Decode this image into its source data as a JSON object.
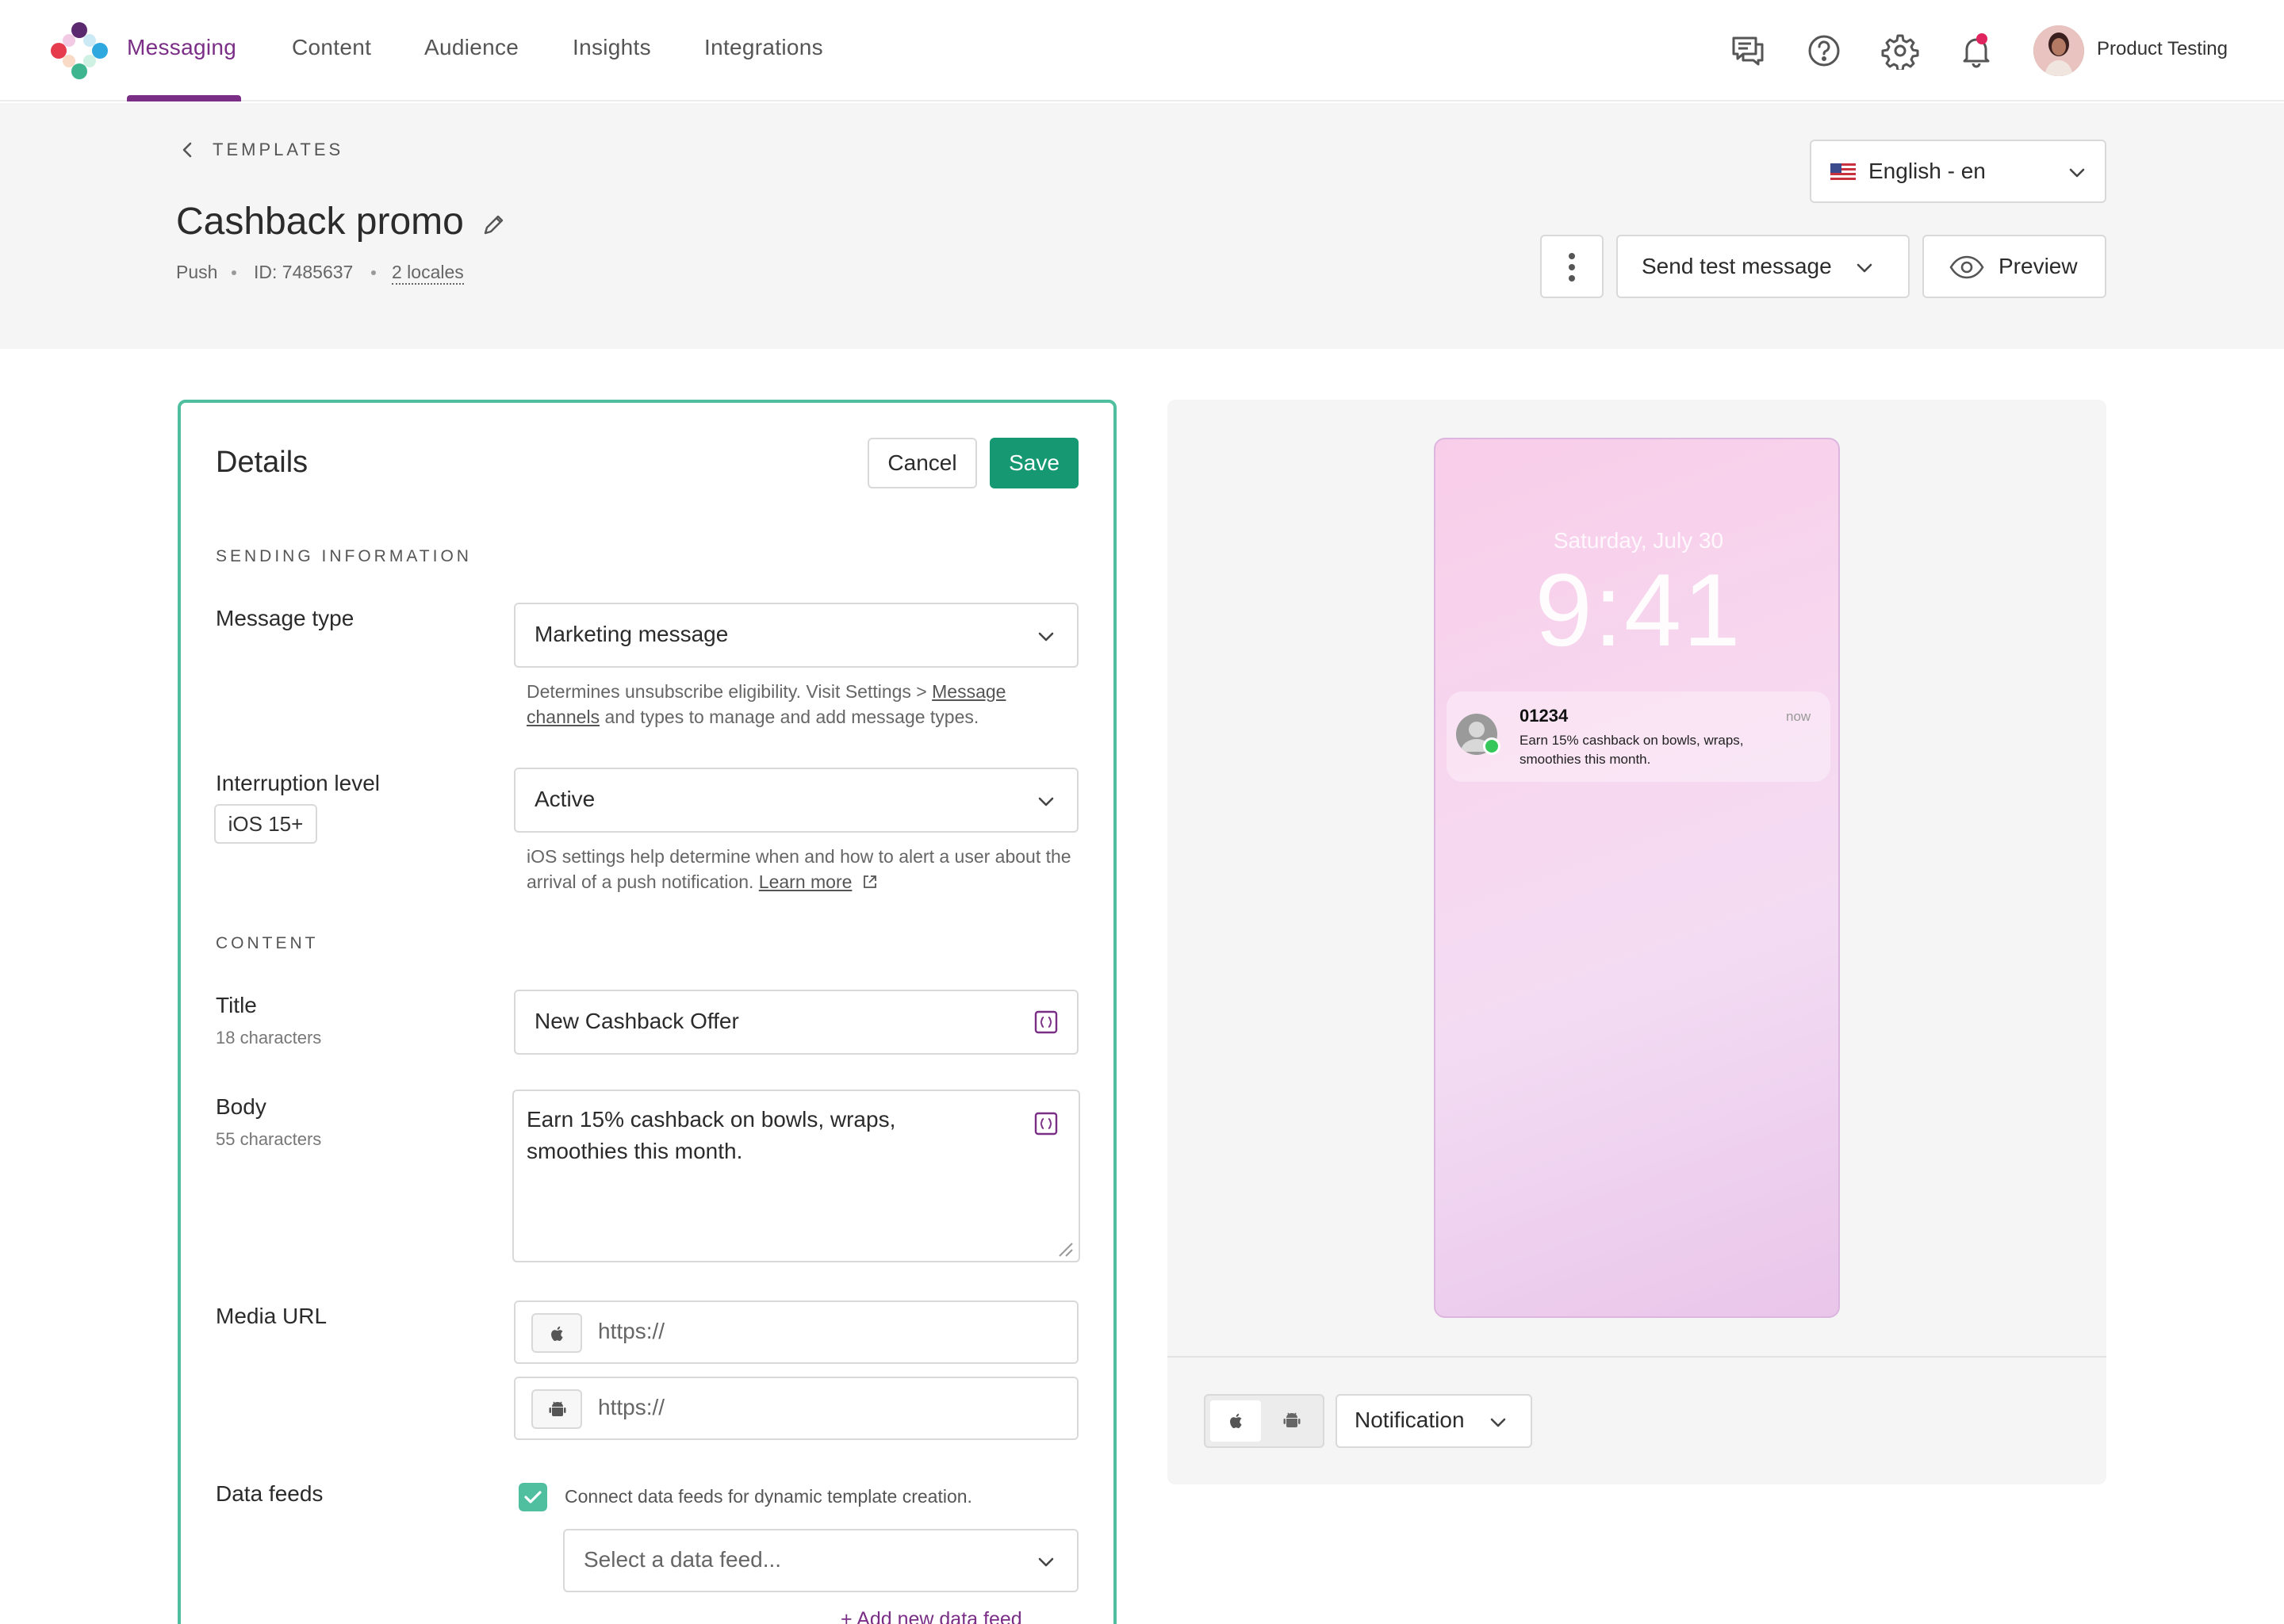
{
  "nav": {
    "tabs": [
      {
        "label": "Messaging",
        "active": true
      },
      {
        "label": "Content",
        "active": false
      },
      {
        "label": "Audience",
        "active": false
      },
      {
        "label": "Insights",
        "active": false
      },
      {
        "label": "Integrations",
        "active": false
      }
    ],
    "icons": [
      "chat-icon",
      "help-icon",
      "gear-icon",
      "bell-icon"
    ],
    "user_name": "Product Testing",
    "accent": "#7a2e86"
  },
  "header": {
    "back_label": "TEMPLATES",
    "title": "Cashback promo",
    "meta": {
      "channel": "Push",
      "id": "ID: 7485637",
      "locales": "2 locales"
    },
    "language": "English - en",
    "send_test_label": "Send test message",
    "preview_label": "Preview"
  },
  "details": {
    "title": "Details",
    "cancel_label": "Cancel",
    "save_label": "Save",
    "sending_section": "SENDING INFORMATION",
    "message_type": {
      "label": "Message type",
      "value": "Marketing message",
      "help_prefix": "Determines unsubscribe eligibility. Visit Settings > ",
      "help_link": "Message channels",
      "help_suffix": " and types to manage and add message types."
    },
    "interruption": {
      "label": "Interruption level",
      "badge": "iOS 15+",
      "value": "Active",
      "help_text": "iOS settings help determine when and how to alert a user about the arrival of a push notification. ",
      "help_link": "Learn more"
    },
    "content_section": "CONTENT",
    "title_field": {
      "label": "Title",
      "count": "18 characters",
      "value": "New Cashback Offer"
    },
    "body_field": {
      "label": "Body",
      "count": "55 characters",
      "value": "Earn 15% cashback on bowls, wraps, smoothies this month."
    },
    "media": {
      "label": "Media URL",
      "ios_placeholder": "https://",
      "android_placeholder": "https://"
    },
    "data_feeds": {
      "label": "Data feeds",
      "checkbox_label": "Connect data feeds for dynamic template creation.",
      "checked": true,
      "select_placeholder": "Select a data feed...",
      "add_label": "+ Add new data feed"
    },
    "save_color": "#169873",
    "border_color": "#4fbf9f"
  },
  "preview": {
    "date": "Saturday, July 30",
    "time": "9:41",
    "notification": {
      "sender": "01234",
      "time": "now",
      "body": "Earn 15% cashback on bowls, wraps, smoothies this month."
    },
    "view_select": "Notification"
  }
}
